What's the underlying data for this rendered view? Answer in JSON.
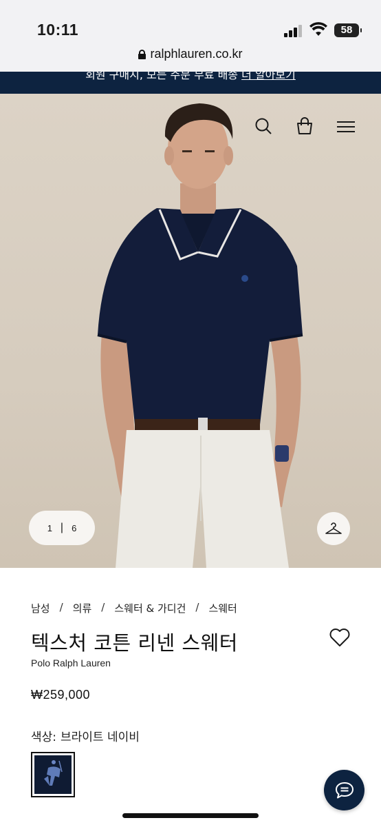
{
  "status": {
    "time": "10:11",
    "battery": "58"
  },
  "browser": {
    "url": "ralphlauren.co.kr"
  },
  "promo": {
    "text": "회원 구매시, 모든 주문 무료 배송",
    "link": "더 알아보기"
  },
  "gallery": {
    "current": "1",
    "separator": "|",
    "total": "6"
  },
  "breadcrumb": [
    "남성",
    "의류",
    "스웨터 & 가디건",
    "스웨터"
  ],
  "breadcrumb_sep": "/",
  "product": {
    "title": "텍스처 코튼 리넨 스웨터",
    "brand": "Polo Ralph Lauren",
    "price": "₩259,000",
    "color_label": "색상:",
    "color_value": "브라이트 네이비"
  },
  "icons": {
    "search": "search-icon",
    "bag": "shopping-bag-icon",
    "menu": "hamburger-menu-icon",
    "hanger": "hanger-icon",
    "wishlist": "heart-icon",
    "chat": "chat-icon",
    "lock": "lock-icon"
  },
  "colors": {
    "navy": "#0d2340",
    "background_hero": "#d6ccbe"
  }
}
